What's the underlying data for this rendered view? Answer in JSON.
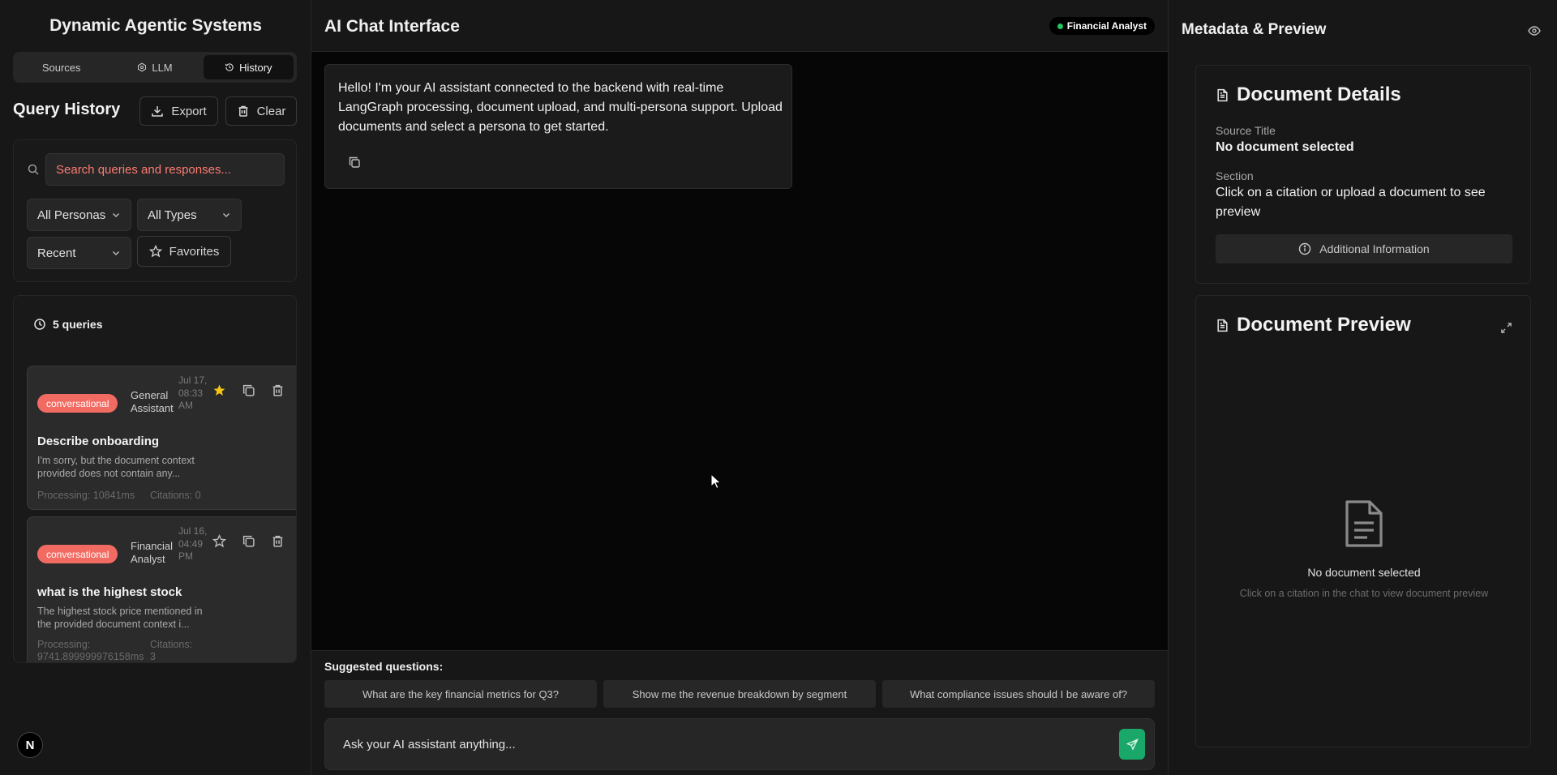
{
  "sidebar": {
    "app_title": "Dynamic Agentic Systems",
    "tabs": [
      {
        "label": "Sources",
        "active": false
      },
      {
        "label": "LLM",
        "active": false
      },
      {
        "label": "History",
        "active": true
      }
    ],
    "section_title": "Query History",
    "export_label": "Export",
    "clear_label": "Clear",
    "search_placeholder": "Search queries and responses...",
    "persona_filter": "All Personas",
    "type_filter": "All Types",
    "sort_filter": "Recent",
    "favorites_label": "Favorites",
    "query_count": "5 queries",
    "items": [
      {
        "type": "conversational",
        "persona": "General Assistant",
        "date": "Jul 17, 08:33 AM",
        "favorited": true,
        "title": "Describe onboarding",
        "response": "I'm sorry, but the document context provided does not contain any...",
        "processing": "Processing: 10841ms",
        "citations": "Citations: 0"
      },
      {
        "type": "conversational",
        "persona": "Financial Analyst",
        "date": "Jul 16, 04:49 PM",
        "favorited": false,
        "title": "what is the highest stock",
        "response": "The highest stock price mentioned in the provided document context i...",
        "processing": "Processing: 9741.899999976158ms",
        "citations": "Citations: 3"
      }
    ],
    "avatar_letter": "N"
  },
  "chat": {
    "title": "AI Chat Interface",
    "active_persona": "Financial Analyst",
    "assistant_message": "Hello! I'm your AI assistant connected to the backend with real-time LangGraph processing, document upload, and multi-persona support. Upload documents and select a persona to get started.",
    "suggested_label": "Suggested questions:",
    "suggestions": [
      "What are the key financial metrics for Q3?",
      "Show me the revenue breakdown by segment",
      "What compliance issues should I be aware of?"
    ],
    "input_placeholder": "Ask your AI assistant anything..."
  },
  "metadata": {
    "title": "Metadata & Preview",
    "details_title": "Document Details",
    "source_title_label": "Source Title",
    "source_title_value": "No document selected",
    "section_label": "Section",
    "section_value": "Click on a citation or upload a document to see preview",
    "additional_info_label": "Additional Information",
    "preview_title": "Document Preview",
    "empty_title": "No document selected",
    "empty_subtitle": "Click on a citation in the chat to view document preview"
  },
  "colors": {
    "badge": "#f26b63",
    "accent_green": "#1aa86a",
    "status_dot": "#22c55e",
    "favorite_star": "#f5c518"
  },
  "icons": [
    "search-icon",
    "download-icon",
    "trash-icon",
    "star-icon",
    "copy-icon",
    "clock-icon",
    "chevron-down-icon",
    "send-icon",
    "eye-icon",
    "file-text-icon",
    "info-icon",
    "expand-icon",
    "history-icon",
    "cpu-icon"
  ]
}
